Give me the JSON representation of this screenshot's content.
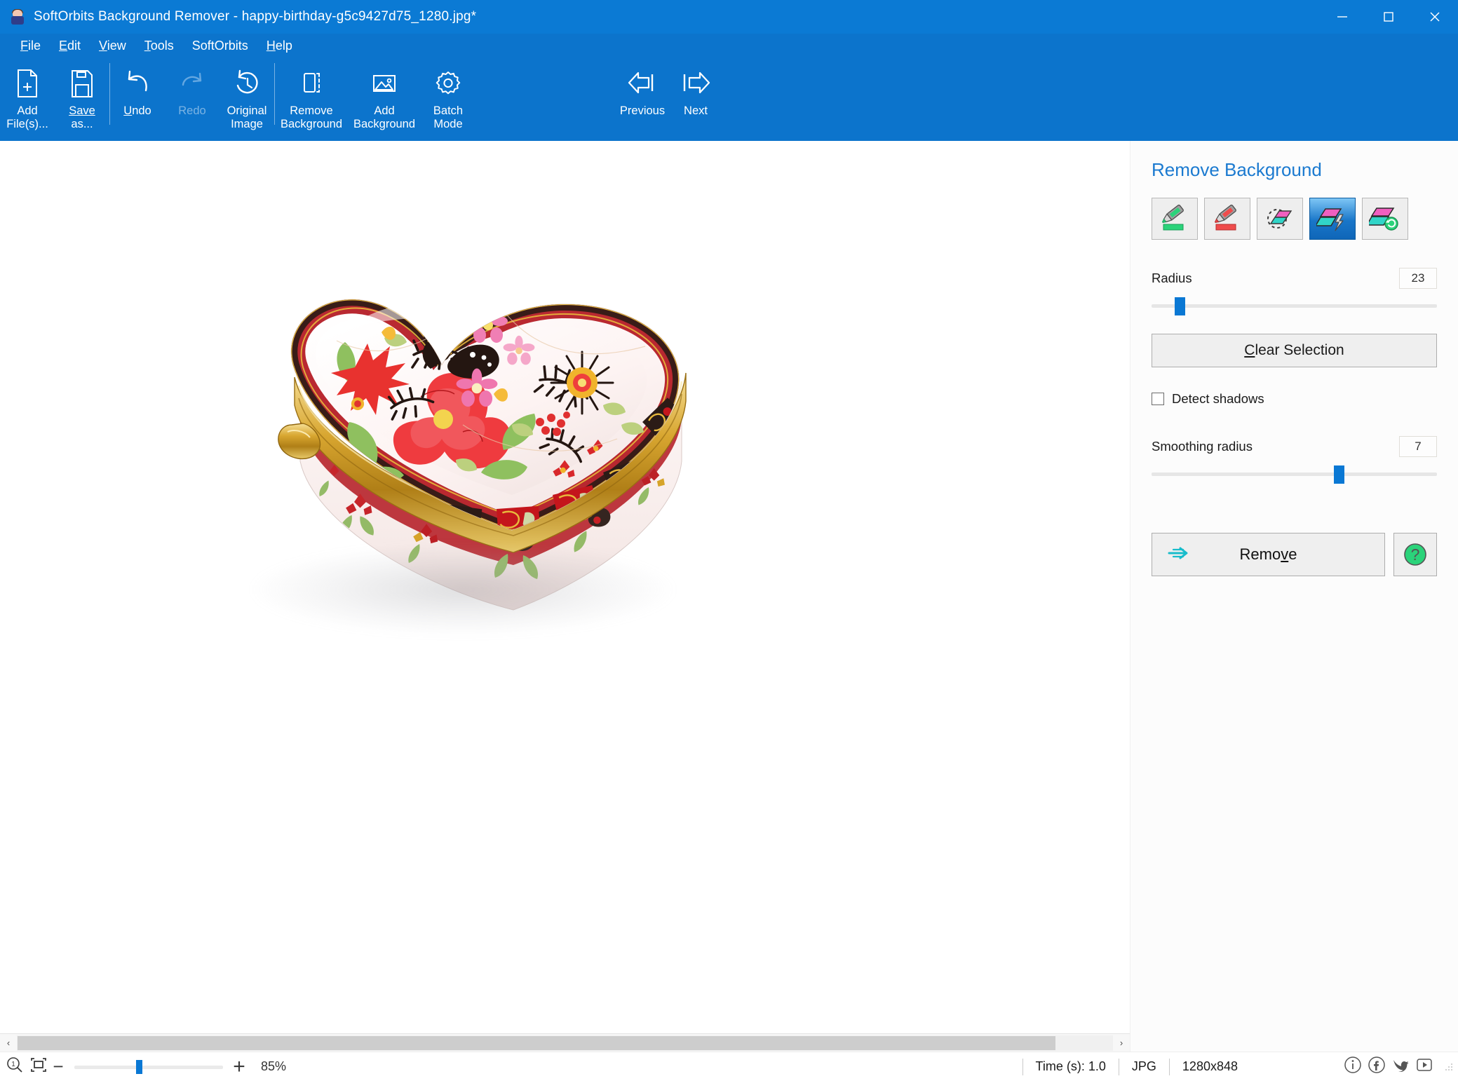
{
  "window": {
    "title": "SoftOrbits Background Remover - happy-birthday-g5c9427d75_1280.jpg*",
    "app_icon": "app-icon",
    "minimize": "minimize-icon",
    "maximize": "maximize-icon",
    "close": "close-icon",
    "titlebar_color": "#0b7ad4",
    "ribbon_color": "#0c74cc"
  },
  "menu": [
    {
      "pre": "",
      "hot": "F",
      "post": "ile"
    },
    {
      "pre": "",
      "hot": "E",
      "post": "dit"
    },
    {
      "pre": "",
      "hot": "V",
      "post": "iew"
    },
    {
      "pre": "",
      "hot": "T",
      "post": "ools"
    },
    {
      "pre": "SoftOrbits",
      "hot": "",
      "post": ""
    },
    {
      "pre": "",
      "hot": "H",
      "post": "elp"
    }
  ],
  "ribbon": {
    "add_files": {
      "line1": "Add",
      "line2": "File(s)..."
    },
    "save_as": {
      "line1": "Save",
      "line2": "as..."
    },
    "undo": {
      "line1": "Undo",
      "line2": ""
    },
    "redo": {
      "line1": "Redo",
      "line2": "",
      "disabled": true
    },
    "original_image": {
      "line1": "Original",
      "line2": "Image"
    },
    "remove_background": {
      "line1": "Remove",
      "line2": "Background"
    },
    "add_background": {
      "line1": "Add",
      "line2": "Background"
    },
    "batch_mode": {
      "line1": "Batch",
      "line2": "Mode"
    },
    "previous": {
      "line1": "Previous",
      "line2": ""
    },
    "next": {
      "line1": "Next",
      "line2": ""
    }
  },
  "panel": {
    "title": "Remove Background",
    "tools": [
      {
        "name": "keep-marker-tool",
        "selected": false,
        "color": "#2bd37a"
      },
      {
        "name": "remove-marker-tool",
        "selected": false,
        "color": "#ef4c4c"
      },
      {
        "name": "magic-wand-selection-tool",
        "selected": false
      },
      {
        "name": "auto-remove-tool",
        "selected": true
      },
      {
        "name": "restore-background-tool",
        "selected": false
      }
    ],
    "radius": {
      "label": "Radius",
      "value": "23",
      "slider_percent": 9
    },
    "clear_selection": {
      "label": "Clear Selection",
      "hotkey": "C"
    },
    "detect_shadows": {
      "label": "Detect shadows",
      "checked": false
    },
    "smoothing_radius": {
      "label": "Smoothing radius",
      "value": "7",
      "slider_percent": 66
    },
    "remove": {
      "label": "Remove",
      "hotkey": "v"
    },
    "help": {
      "label": "?"
    }
  },
  "canvas": {
    "image_alt": "heart-shaped floral porcelain trinket box",
    "scroll_arrow_left": "‹",
    "scroll_arrow_right": "›"
  },
  "statusbar": {
    "zoom_fit_icon": "zoom-actual-size-icon",
    "fit_screen_icon": "fit-to-screen-icon",
    "zoom_out": "−",
    "zoom_in": "+",
    "zoom_percent": "85%",
    "zoom_slider_percent": 42,
    "time": "Time (s): 1.0",
    "format": "JPG",
    "dimensions": "1280x848",
    "social": [
      {
        "name": "info-icon",
        "glyph": "i"
      },
      {
        "name": "facebook-icon",
        "glyph": "f"
      },
      {
        "name": "twitter-icon",
        "glyph": "t"
      },
      {
        "name": "youtube-icon",
        "glyph": "▶"
      }
    ]
  }
}
